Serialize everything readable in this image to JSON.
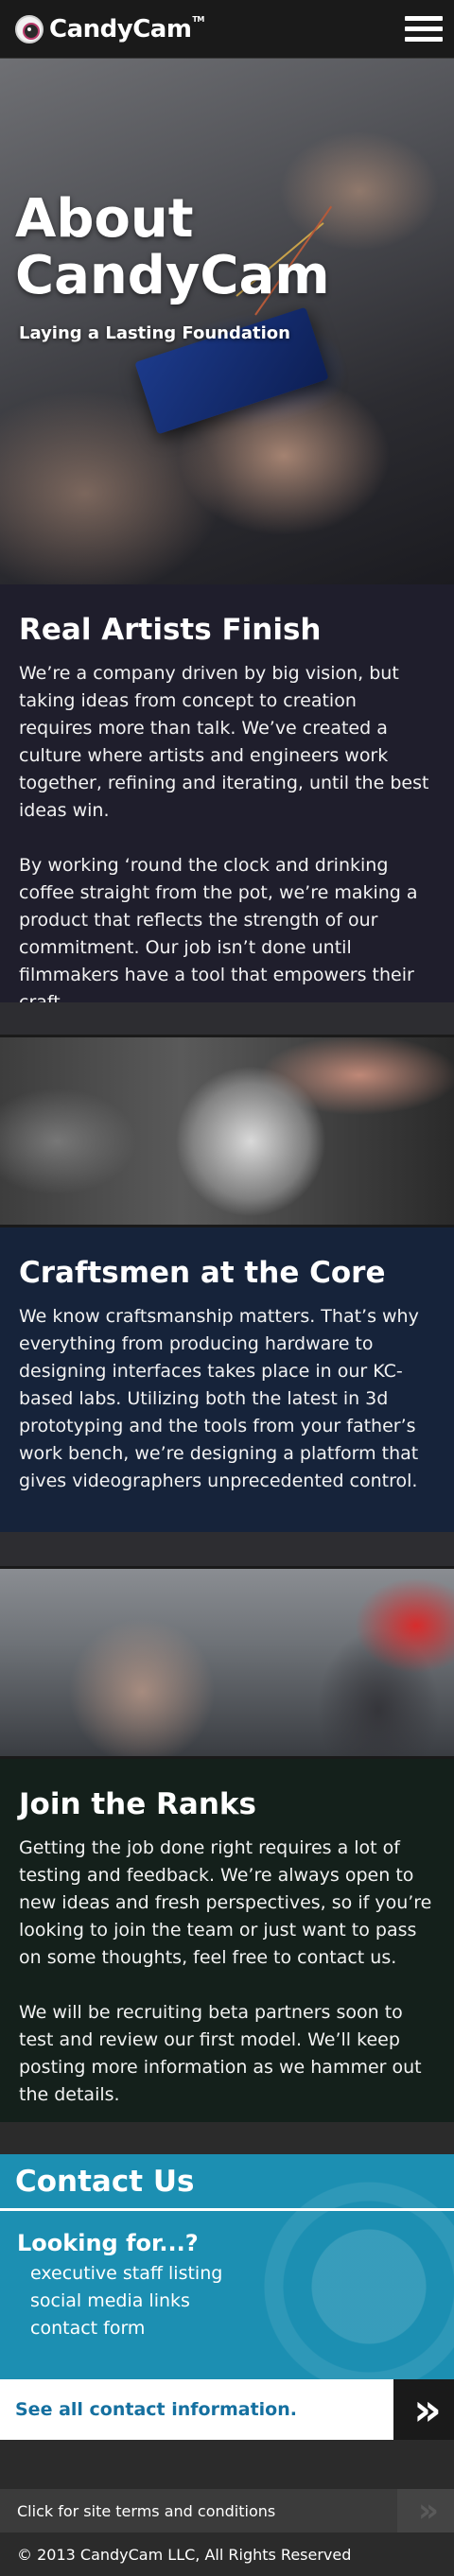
{
  "header": {
    "logo_text": "CandyCam",
    "logo_tm": "TM"
  },
  "hero": {
    "title": "About CandyCam",
    "subtitle": "Laying a Lasting Foundation"
  },
  "sections": [
    {
      "heading": "Real Artists Finish",
      "paragraphs": [
        "We’re a company driven by big vision, but taking ideas from concept to creation requires more than talk. We’ve created a culture where artists and engineers work together, refining and iterating, until the best ideas win.",
        "By working ‘round the clock and drinking coffee straight from the pot, we’re making a product that reflects the strength of our commitment. Our job isn’t done until filmmakers have a tool that empowers their craft."
      ]
    },
    {
      "heading": "Craftsmen at the Core",
      "paragraphs": [
        "We know craftsmanship matters. That’s why everything from producing hardware to designing interfaces takes place in our KC-based labs. Utilizing both the latest in 3d prototyping and the tools from your father’s work bench, we’re designing a platform that gives videographers unprecedented control."
      ]
    },
    {
      "heading": "Join the Ranks",
      "paragraphs": [
        "Getting the job done right requires a lot of testing and feedback. We’re always open to new ideas and fresh perspectives, so if you’re looking to join the team or just want to pass on some thoughts, feel free to contact us.",
        "We will be recruiting beta partners soon to test and review our first model. We’ll keep posting more information as we hammer out the details."
      ]
    }
  ],
  "contact": {
    "title": "Contact Us",
    "subtitle": "Looking for...?",
    "links": [
      "executive staff listing",
      "social media links",
      "contact form"
    ],
    "see_all": "See all contact information.",
    "see_all_arrow": "»"
  },
  "footer": {
    "terms": "Click for site terms and conditions",
    "terms_arrow": "»",
    "copyright": "© 2013 CandyCam LLC, All Rights Reserved"
  }
}
